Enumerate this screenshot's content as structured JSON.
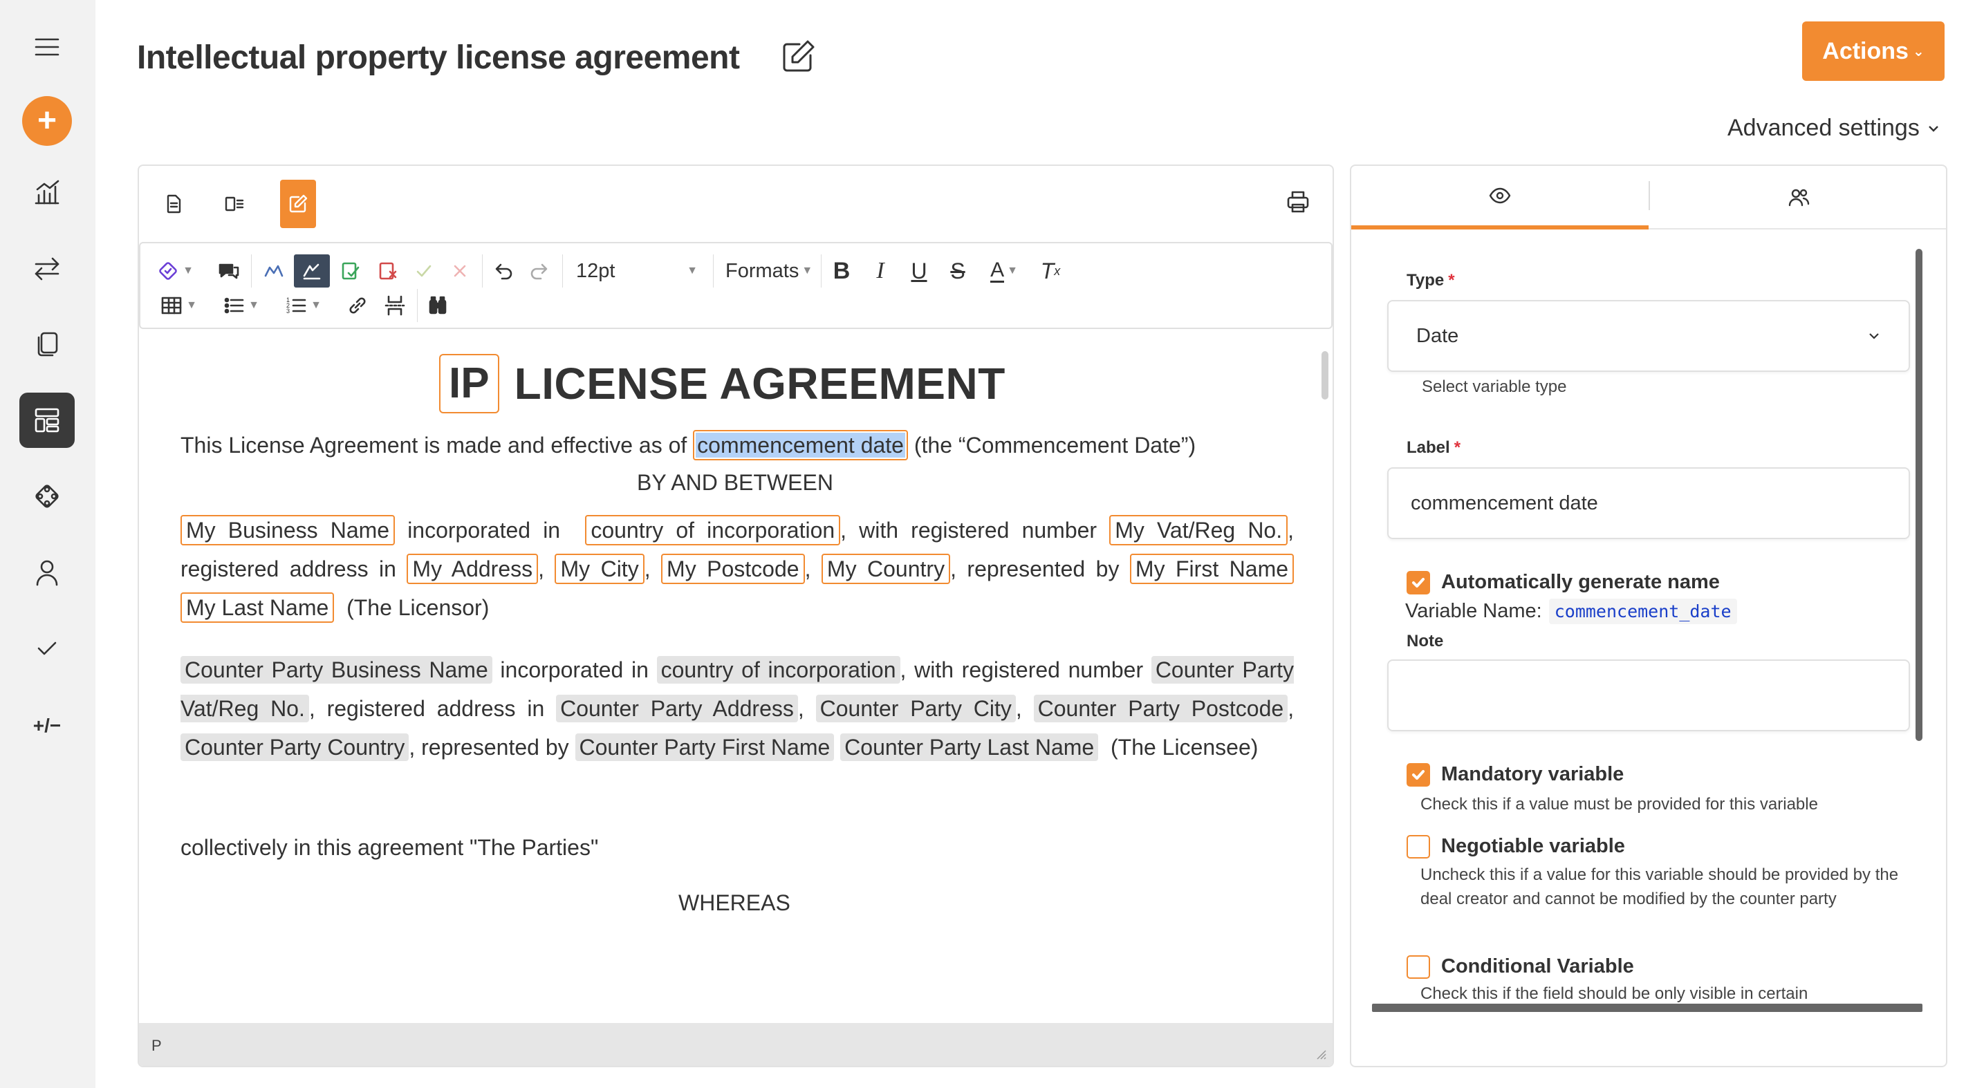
{
  "sidebar": {
    "items": [
      {
        "icon": "menu-icon"
      },
      {
        "icon": "plus-icon",
        "label": "+"
      },
      {
        "icon": "chart-icon"
      },
      {
        "icon": "swap-icon"
      },
      {
        "icon": "documents-icon"
      },
      {
        "icon": "templates-icon"
      },
      {
        "icon": "integrations-icon"
      },
      {
        "icon": "user-icon"
      },
      {
        "icon": "checkmark-icon"
      },
      {
        "icon": "diff-icon",
        "label": "+/−"
      }
    ]
  },
  "header": {
    "title": "Intellectual property license agreement",
    "actions_label": "Actions",
    "advanced_settings_label": "Advanced settings"
  },
  "toolbar": {
    "font_size": "12pt",
    "formats_label": "Formats"
  },
  "document": {
    "ip_label": "IP",
    "heading": "LICENSE AGREEMENT",
    "intro_before": "This License Agreement is made and effective as of",
    "commencement_var": "commencement date",
    "intro_after": "(the “Commencement Date”)",
    "between": "BY AND BETWEEN",
    "licensor": {
      "business_name": "My Business Name",
      "t_incorporated_in": "incorporated in",
      "country": "country of incorporation",
      "t_with_reg": ", with registered number",
      "vat": "My Vat/Reg No.",
      "t_comma": ",",
      "t_reg_address": "registered address in",
      "address": "My Address",
      "city": "My City",
      "postcode": "My Postcode",
      "country_name": "My Country",
      "t_represented": ", represented by",
      "first_name": "My First Name",
      "last_name": "My Last Name",
      "t_role": "(The Licensor)"
    },
    "licensee": {
      "business_name": "Counter Party Business Name",
      "t_incorporated_in": "incorporated in",
      "country": "country of incorporation",
      "t_with_reg": ", with registered number",
      "vat": "Counter Party Vat/Reg No.",
      "t_reg_address": ", registered address in",
      "address": "Counter Party Address",
      "city": "Counter Party City",
      "postcode": "Counter Party Postcode",
      "country_name": "Counter Party Country",
      "t_represented": ", represented by",
      "first_name": "Counter Party First Name",
      "last_name": "Counter Party Last Name",
      "t_role": "(The Licensee)"
    },
    "collectively": "collectively in this agreement \"The Parties\"",
    "whereas": "WHEREAS",
    "status_path": "P"
  },
  "panel": {
    "type_label": "Type",
    "type_value": "Date",
    "type_help": "Select variable type",
    "label_label": "Label",
    "label_value": "commencement date",
    "auto_name_label": "Automatically generate name",
    "auto_name_checked": true,
    "variable_name_label": "Variable Name:",
    "variable_name_value": "commencement_date",
    "note_label": "Note",
    "note_value": "",
    "mandatory_label": "Mandatory variable",
    "mandatory_checked": true,
    "mandatory_help": "Check this if a value must be provided for this variable",
    "negotiable_label": "Negotiable variable",
    "negotiable_checked": false,
    "negotiable_help": "Uncheck this if a value for this variable should be provided by the deal creator and cannot be modified by the counter party",
    "conditional_label": "Conditional Variable",
    "conditional_checked": false,
    "conditional_help": "Check this if the field should be only visible in certain"
  },
  "colors": {
    "accent": "#f28b31",
    "selection": "#b4d2f7",
    "required": "#e0323c",
    "variable_name": "#1a3fc9"
  }
}
